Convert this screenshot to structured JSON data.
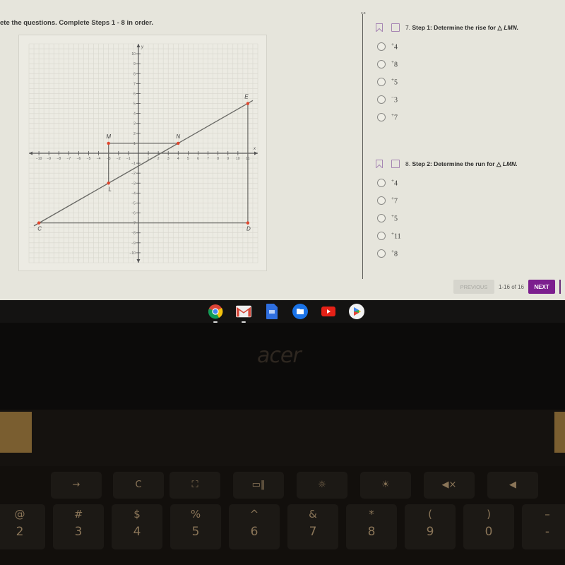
{
  "instructions": "ete the questions.   Complete Steps 1 - 8 in order.",
  "graph": {
    "x_range": [
      -10,
      11
    ],
    "y_range": [
      -10,
      10
    ],
    "x_label": "x",
    "y_label": "y",
    "x_ticks": [
      -10,
      -9,
      -8,
      -7,
      -6,
      -5,
      -4,
      -3,
      -2,
      -1,
      1,
      2,
      3,
      4,
      5,
      6,
      7,
      8,
      9,
      10,
      11
    ],
    "y_ticks": [
      -10,
      -9,
      -8,
      -7,
      -6,
      -5,
      -4,
      -3,
      -2,
      -1,
      1,
      2,
      3,
      4,
      5,
      6,
      7,
      8,
      9,
      10
    ],
    "points": [
      {
        "label": "M",
        "x": -3,
        "y": 1
      },
      {
        "label": "N",
        "x": 4,
        "y": 1
      },
      {
        "label": "L",
        "x": -3,
        "y": -3
      },
      {
        "label": "E",
        "x": 11,
        "y": 5
      },
      {
        "label": "C",
        "x": -10,
        "y": -7
      },
      {
        "label": "D",
        "x": 11,
        "y": -7
      }
    ],
    "line": {
      "from": {
        "x": -10.5,
        "y": -7.3
      },
      "to": {
        "x": 11.5,
        "y": 5.3
      }
    },
    "segments": [
      [
        "M",
        "N"
      ],
      [
        "M",
        "L"
      ],
      [
        "C",
        "D"
      ],
      [
        "E",
        "D"
      ]
    ],
    "point_color": "#e0452c",
    "line_color": "#6a6a66"
  },
  "questions": [
    {
      "number": "7.",
      "title": "Step 1: Determine the rise for",
      "triangle": "△",
      "name": "LMN.",
      "options": [
        {
          "sign": "+",
          "value": "4"
        },
        {
          "sign": "+",
          "value": "8"
        },
        {
          "sign": "+",
          "value": "5"
        },
        {
          "sign": "−",
          "value": "3"
        },
        {
          "sign": "+",
          "value": "7"
        }
      ]
    },
    {
      "number": "8.",
      "title": "Step 2: Determine the run for",
      "triangle": "△",
      "name": "LMN.",
      "options": [
        {
          "sign": "+",
          "value": "4"
        },
        {
          "sign": "+",
          "value": "7"
        },
        {
          "sign": "+",
          "value": "5"
        },
        {
          "sign": "+",
          "value": "11"
        },
        {
          "sign": "+",
          "value": "8"
        }
      ]
    }
  ],
  "pager": {
    "previous_label": "PREVIOUS",
    "count": "1-16 of 16",
    "next_label": "NEXT",
    "accent": "#7c1f8e"
  },
  "shelf": {
    "apps": [
      "chrome",
      "gmail",
      "docs",
      "files",
      "youtube",
      "play-store"
    ]
  },
  "brand": "acer",
  "keyboard": {
    "function_keys": [
      "→",
      "C",
      "⛶",
      "▭‖",
      "☼",
      "☀",
      "◀×",
      "◀"
    ],
    "number_keys": [
      {
        "top": "@",
        "bottom": "2"
      },
      {
        "top": "#",
        "bottom": "3"
      },
      {
        "top": "$",
        "bottom": "4"
      },
      {
        "top": "%",
        "bottom": "5"
      },
      {
        "top": "^",
        "bottom": "6"
      },
      {
        "top": "&",
        "bottom": "7"
      },
      {
        "top": "*",
        "bottom": "8"
      },
      {
        "top": "(",
        "bottom": "9"
      },
      {
        "top": ")",
        "bottom": "0"
      },
      {
        "top": "–",
        "bottom": "-"
      }
    ]
  }
}
